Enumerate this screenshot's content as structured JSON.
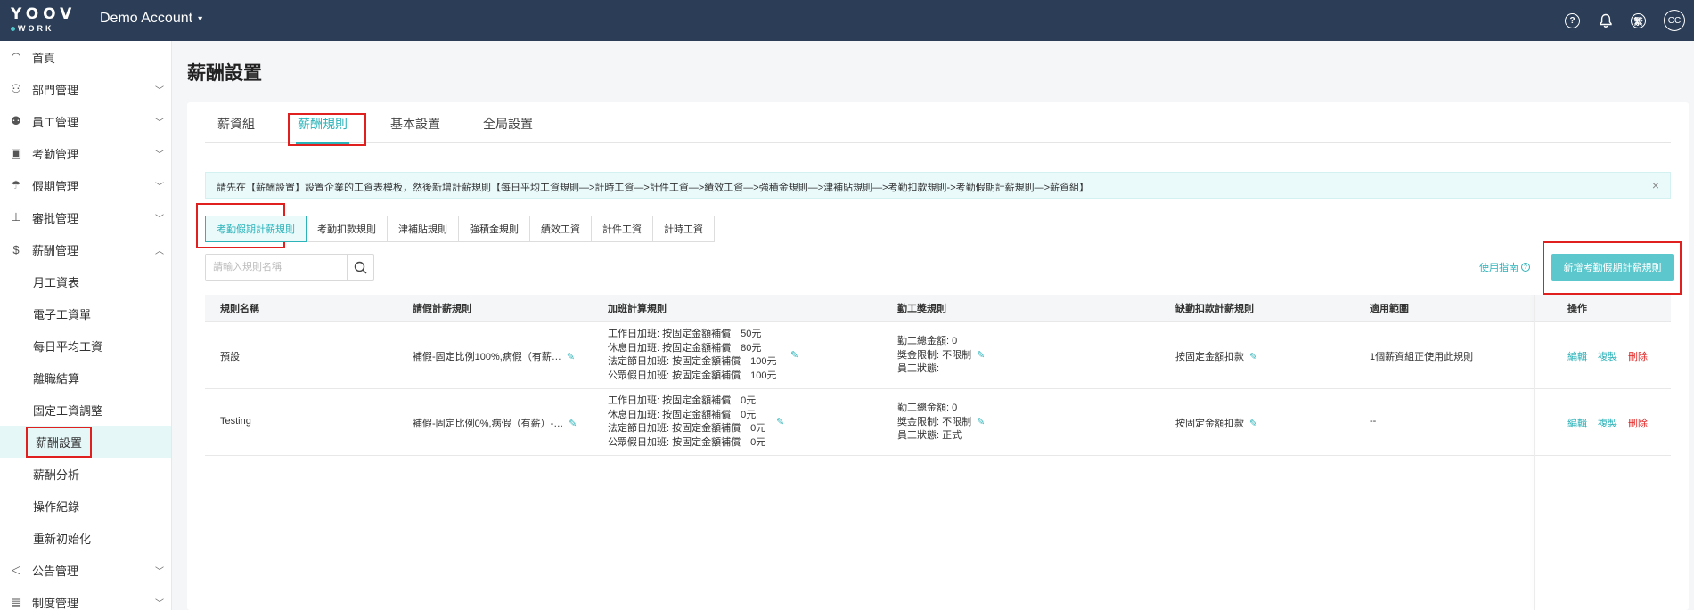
{
  "header": {
    "logo_line1": "YOOV",
    "logo_line2": "WORK",
    "account": "Demo Account",
    "avatar": "CC"
  },
  "sidebar": {
    "items": [
      {
        "label": "首頁",
        "icon": "dashboard-icon",
        "chevron": ""
      },
      {
        "label": "部門管理",
        "icon": "org-icon",
        "chevron": "⌄"
      },
      {
        "label": "員工管理",
        "icon": "staff-icon",
        "chevron": "⌄"
      },
      {
        "label": "考勤管理",
        "icon": "calendar-icon",
        "chevron": "⌄"
      },
      {
        "label": "假期管理",
        "icon": "beach-icon",
        "chevron": "⌄"
      },
      {
        "label": "審批管理",
        "icon": "stamp-icon",
        "chevron": "⌄"
      },
      {
        "label": "薪酬管理",
        "icon": "dollar-icon",
        "chevron": "⌃"
      }
    ],
    "sub_items": [
      "月工資表",
      "電子工資單",
      "每日平均工資",
      "離職結算",
      "固定工資調整",
      "薪酬設置",
      "薪酬分析",
      "操作紀錄",
      "重新初始化"
    ],
    "bottom_items": [
      {
        "label": "公告管理",
        "icon": "megaphone-icon",
        "chevron": "⌄"
      },
      {
        "label": "制度管理",
        "icon": "book-icon",
        "chevron": "⌄"
      }
    ]
  },
  "page": {
    "title": "薪酬設置",
    "tabs": [
      "薪資組",
      "薪酬規則",
      "基本設置",
      "全局設置"
    ],
    "notice": "請先在【薪酬設置】設置企業的工資表模板，然後新增計薪規則【每日平均工資規則—>計時工資—>計件工資—>績效工資—>強積金規則—>津補貼規則—>考勤扣款規則->考勤假期計薪規則—>薪資組】",
    "subtabs": [
      "考勤假期計薪規則",
      "考勤扣款規則",
      "津補貼規則",
      "強積金規則",
      "績效工資",
      "計件工資",
      "計時工資"
    ],
    "search_placeholder": "請輸入規則名稱",
    "guide": "使用指南",
    "add_button": "新增考勤假期計薪規則"
  },
  "table": {
    "columns": [
      "規則名稱",
      "請假計薪規則",
      "加班計算規則",
      "勤工獎規則",
      "缺勤扣款計薪規則",
      "適用範圍",
      "操作"
    ],
    "rows": [
      {
        "name": "預設",
        "leave": "補假-固定比例100%,病假（有薪…",
        "overtime": [
          "工作日加班: 按固定金額補償　50元",
          "休息日加班: 按固定金額補償　80元",
          "法定節日加班: 按固定金額補償　100元",
          "公眾假日加班: 按固定金額補償　100元"
        ],
        "attendance": [
          "勤工總金額: 0",
          "獎金限制: 不限制",
          "員工狀態:"
        ],
        "absence": "按固定金額扣款",
        "scope": "1個薪資組正使用此規則",
        "ops": [
          "編輯",
          "複製",
          "刪除"
        ]
      },
      {
        "name": "Testing",
        "leave": "補假-固定比例0%,病假（有薪）-…",
        "overtime": [
          "工作日加班: 按固定金額補償　0元",
          "休息日加班: 按固定金額補償　0元",
          "法定節日加班: 按固定金額補償　0元",
          "公眾假日加班: 按固定金額補償　0元"
        ],
        "attendance": [
          "勤工總金額: 0",
          "獎金限制: 不限制",
          "員工狀態: 正式"
        ],
        "absence": "按固定金額扣款",
        "scope": "--",
        "ops": [
          "編輯",
          "複製",
          "刪除"
        ]
      }
    ]
  }
}
